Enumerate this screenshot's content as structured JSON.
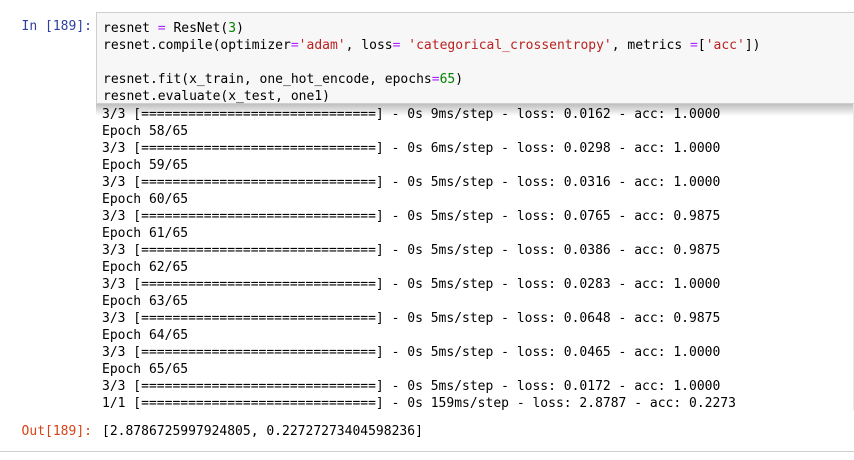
{
  "in_prompt": "In [189]:",
  "out_prompt": "Out[189]:",
  "code": {
    "l1_a": "resnet ",
    "l1_op": "=",
    "l1_b": " ResNet(",
    "l1_num": "3",
    "l1_c": ")",
    "l2_a": "resnet.compile(optimizer",
    "l2_op1": "=",
    "l2_str1": "'adam'",
    "l2_b": ", loss",
    "l2_op2": "=",
    "l2_c": " ",
    "l2_str2": "'categorical_crossentropy'",
    "l2_d": ", metrics ",
    "l2_op3": "=",
    "l2_e": "[",
    "l2_str3": "'acc'",
    "l2_f": "])",
    "l4_a": "resnet.fit(x_train, one_hot_encode, epochs",
    "l4_op": "=",
    "l4_num": "65",
    "l4_b": ")",
    "l5": "resnet.evaluate(x_test, one1)"
  },
  "output_log": "3/3 [==============================] - 0s 9ms/step - loss: 0.0162 - acc: 1.0000\nEpoch 58/65\n3/3 [==============================] - 0s 6ms/step - loss: 0.0298 - acc: 1.0000\nEpoch 59/65\n3/3 [==============================] - 0s 5ms/step - loss: 0.0316 - acc: 1.0000\nEpoch 60/65\n3/3 [==============================] - 0s 5ms/step - loss: 0.0765 - acc: 0.9875\nEpoch 61/65\n3/3 [==============================] - 0s 5ms/step - loss: 0.0386 - acc: 0.9875\nEpoch 62/65\n3/3 [==============================] - 0s 5ms/step - loss: 0.0283 - acc: 1.0000\nEpoch 63/65\n3/3 [==============================] - 0s 5ms/step - loss: 0.0648 - acc: 0.9875\nEpoch 64/65\n3/3 [==============================] - 0s 5ms/step - loss: 0.0465 - acc: 1.0000\nEpoch 65/65\n3/3 [==============================] - 0s 5ms/step - loss: 0.0172 - acc: 1.0000\n1/1 [==============================] - 0s 159ms/step - loss: 2.8787 - acc: 0.2273",
  "result": "[2.8786725997924805, 0.22727273404598236]",
  "colors": {
    "in_prompt": "#303f9f",
    "out_prompt": "#d84315",
    "string": "#ba2121",
    "operator": "#aa22ff",
    "number": "#008000",
    "cell_bg": "#f7f7f7"
  }
}
